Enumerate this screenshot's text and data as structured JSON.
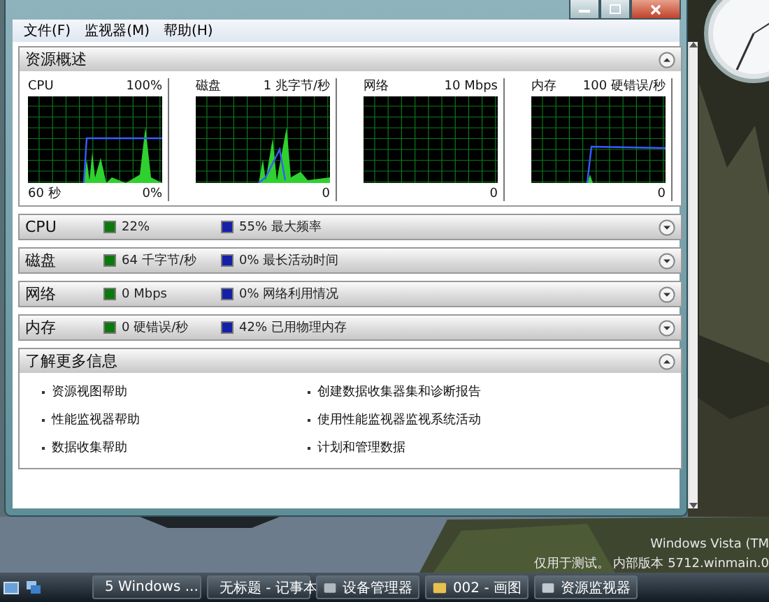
{
  "menu": [
    {
      "label": "文件(F)"
    },
    {
      "label": "监视器(M)"
    },
    {
      "label": "帮助(H)"
    }
  ],
  "overview": {
    "title": "资源概述",
    "expanded": true,
    "graphs": [
      {
        "label": "CPU",
        "scale": "100%",
        "time": "60 秒",
        "min": "0%"
      },
      {
        "label": "磁盘",
        "scale": "1 兆字节/秒",
        "min": "0"
      },
      {
        "label": "网络",
        "scale": "10 Mbps",
        "min": "0"
      },
      {
        "label": "内存",
        "scale": "100 硬错误/秒",
        "min": "0"
      }
    ]
  },
  "sections": [
    {
      "title": "CPU",
      "expanded": false,
      "stat_1": "22%",
      "stat_2": "55% 最大频率"
    },
    {
      "title": "磁盘",
      "expanded": false,
      "stat_1": "64 千字节/秒",
      "stat_2": "0% 最长活动时间"
    },
    {
      "title": "网络",
      "expanded": false,
      "stat_1": "0 Mbps",
      "stat_2": "0% 网络利用情况"
    },
    {
      "title": "内存",
      "expanded": false,
      "stat_1": "0 硬错误/秒",
      "stat_2": "42% 已用物理内存"
    }
  ],
  "learn_more": {
    "title": "了解更多信息",
    "expanded": true,
    "links": [
      "资源视图帮助",
      "创建数据收集器集和诊断报告",
      "性能监视器帮助",
      "使用性能监视器监视系统活动",
      "数据收集帮助",
      "计划和管理数据"
    ]
  },
  "desktop": {
    "os_name": "Windows Vista (TM",
    "build": "仅用于测试。 内部版本 5712.winmain.0"
  },
  "taskbar": {
    "items": [
      {
        "label": "5 Windows ...",
        "kind": "group"
      },
      {
        "label": "无标题 - 记事本",
        "kind": "notepad"
      },
      {
        "label": "设备管理器",
        "kind": "devices"
      },
      {
        "label": "002 - 画图",
        "kind": "paint"
      },
      {
        "label": "资源监视器",
        "kind": "monitor"
      }
    ]
  }
}
